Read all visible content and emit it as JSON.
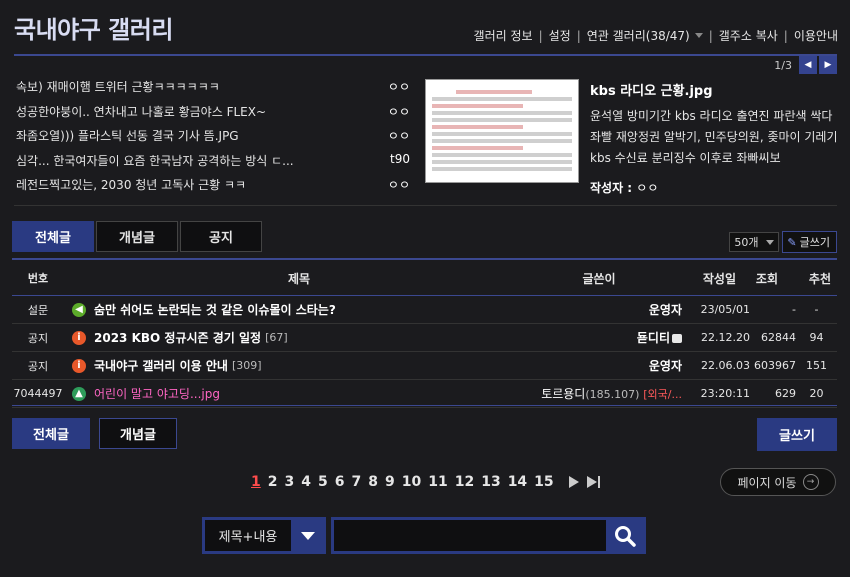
{
  "header": {
    "title": "국내야구 갤러리",
    "nav": [
      "갤러리 정보",
      "설정",
      "연관 갤러리(38/47)",
      "갤주소 복사",
      "이용안내"
    ]
  },
  "featured": {
    "pager": "1/3",
    "news": [
      {
        "title": "속보) 재매이햄 트위터 근황ㅋㅋㅋㅋㅋㅋ",
        "author": "ㅇㅇ"
      },
      {
        "title": "성공한야붕이.. 연차내고 나홀로 황금야스 FLEX~",
        "author": "ㅇㅇ"
      },
      {
        "title": "좌좀오열))) 플라스틱 선동 결국 기사 뜸.JPG",
        "author": "ㅇㅇ"
      },
      {
        "title": "심각... 한국여자들이 요즘 한국남자 공격하는 방식 ㄷ...",
        "author": "t90"
      },
      {
        "title": "레전드찍고있는, 2030 청년 고독사 근황 ㅋㅋ",
        "author": "ㅇㅇ"
      }
    ],
    "main": {
      "title": "kbs 라디오 근황.jpg",
      "desc": "윤석열 방미기간 kbs 라디오 출연진 파란색 싹다 좌빨 재앙정권 알박기, 민주당의원, 좆마이 기레기 kbs 수신료 분리징수 이후로 좌빠씨보",
      "author_label": "작성자",
      "author": "ㅇㅇ"
    }
  },
  "tabs": [
    "전체글",
    "개념글",
    "공지"
  ],
  "list_count": "50개",
  "write_small": "글쓰기",
  "table": {
    "headers": [
      "번호",
      "제목",
      "글쓴이",
      "작성일",
      "조회",
      "추천"
    ],
    "rows": [
      {
        "no": "설문",
        "icon": "survey-icon",
        "subject": "숨만 쉬어도 논란되는 것 같은 이슈몰이 스타는?",
        "replies": "",
        "writer": "운영자",
        "writer_extra": "",
        "date": "23/05/01",
        "views": "-",
        "recs": "-"
      },
      {
        "no": "공지",
        "icon": "notice-icon",
        "subject": "2023 KBO 정규시즌 경기 일정",
        "replies": "[67]",
        "writer": "됻디티",
        "writer_extra": "",
        "date": "22.12.20",
        "views": "62844",
        "recs": "94"
      },
      {
        "no": "공지",
        "icon": "notice-icon",
        "subject": "국내야구 갤러리 이용 안내",
        "replies": "[309]",
        "writer": "운영자",
        "writer_extra": "",
        "date": "22.06.03",
        "views": "603967",
        "recs": "151"
      },
      {
        "no": "7044497",
        "icon": "image-icon",
        "subject": "어린이 말고 야고딩...jpg",
        "replies": "",
        "writer": "토르용디",
        "writer_ip": "(185.107)",
        "writer_tag": "[외국/...",
        "date": "23:20:11",
        "views": "629",
        "recs": "20"
      }
    ]
  },
  "bottom": {
    "tabs": [
      "전체글",
      "개념글"
    ],
    "write": "글쓰기",
    "pages": [
      "1",
      "2",
      "3",
      "4",
      "5",
      "6",
      "7",
      "8",
      "9",
      "10",
      "11",
      "12",
      "13",
      "14",
      "15"
    ],
    "goto": "페이지 이동"
  },
  "search": {
    "scope": "제목+내용",
    "placeholder": ""
  }
}
